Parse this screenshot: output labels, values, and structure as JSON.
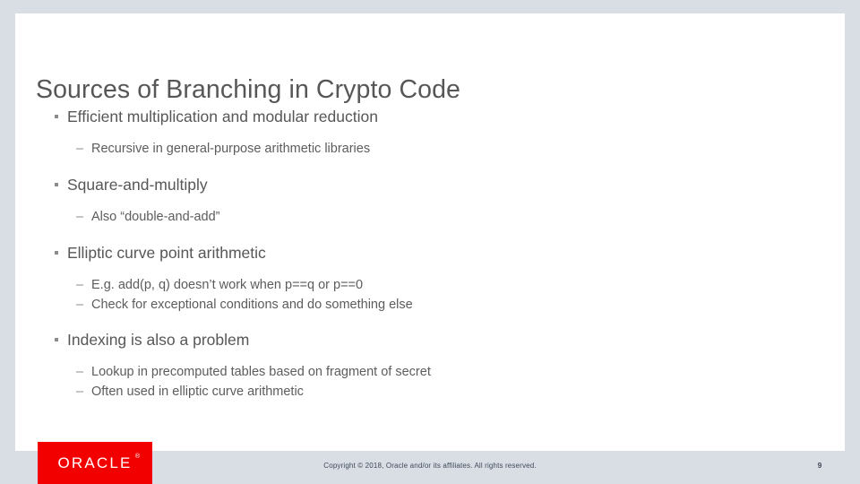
{
  "slide": {
    "title": "Sources of Branching in Crypto Code",
    "content": [
      {
        "level1": "Efficient multiplication and modular reduction",
        "sub": [
          "– Recursive in general-purpose arithmetic libraries"
        ]
      },
      {
        "level1": "Square-and-multiply",
        "sub": [
          "– Also “double-and-add”"
        ]
      },
      {
        "level1": "Elliptic curve point arithmetic",
        "sub": [
          "– E.g. add(p, q) doesn’t work when p==q or p==0",
          "– Check for exceptional conditions and do something else"
        ]
      },
      {
        "level1": "Indexing is also a problem",
        "sub": [
          "– Lookup in precomputed tables based on fragment of secret",
          "– Often used in elliptic curve arithmetic"
        ]
      }
    ],
    "bullets": {
      "b1": "Efficient multiplication and modular reduction",
      "b1s1": "Recursive in general-purpose arithmetic libraries",
      "b2": "Square-and-multiply",
      "b2s1": "Also “double-and-add”",
      "b3": "Elliptic curve point arithmetic",
      "b3s1": "E.g. add(p, q) doesn’t work when p==q or p==0",
      "b3s2": "Check for exceptional conditions and do something else",
      "b4": "Indexing is also a problem",
      "b4s1": "Lookup in precomputed tables based on fragment of secret",
      "b4s2": "Often used in elliptic curve arithmetic"
    },
    "dash_marker": "–"
  },
  "footer": {
    "logo_text": "ORACLE",
    "logo_tm": "®",
    "copyright": "Copyright © 2018, Oracle and/or its affiliates. All rights reserved.",
    "page_number": "9"
  },
  "colors": {
    "canvas_gray": "#d8dee4",
    "slide_white": "#ffffff",
    "title_gray": "#575757",
    "body_gray": "#5c5c5c",
    "marker_gray": "#8c8c8c",
    "oracle_red": "#f20000",
    "footer_text": "#40495a"
  }
}
